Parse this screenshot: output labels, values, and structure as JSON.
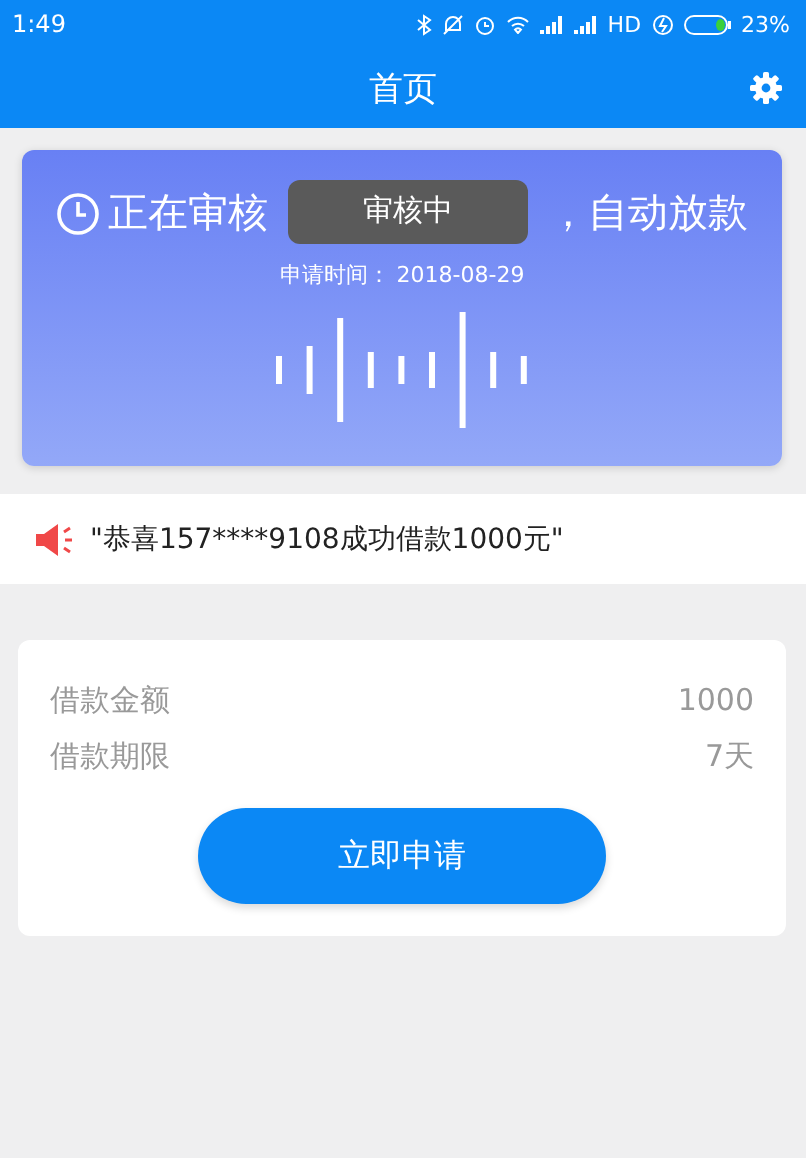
{
  "status_bar": {
    "time": "1:49",
    "network": "HD",
    "battery": "23%"
  },
  "header": {
    "title": "首页"
  },
  "review_card": {
    "headline_start": "正在审核",
    "headline_end": "，自动放款",
    "apply_time": "申请时间：  2018-08-29"
  },
  "toast": {
    "text": "审核中"
  },
  "notice": {
    "text": "\"恭喜157****9108成功借款1000元\""
  },
  "loan_form": {
    "rows": [
      {
        "label": "借款金额",
        "value": "1000"
      },
      {
        "label": "借款期限",
        "value": "7天"
      }
    ],
    "button": "立即申请"
  }
}
